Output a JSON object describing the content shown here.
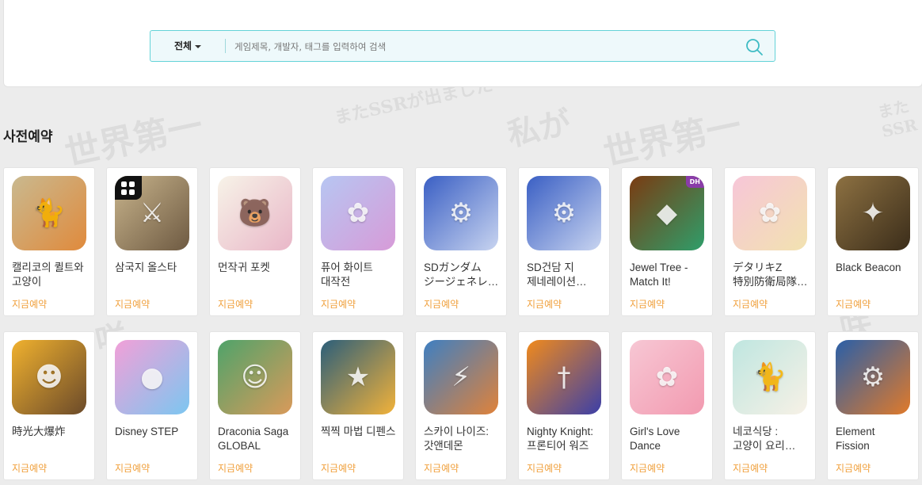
{
  "search": {
    "category": "전체",
    "placeholder": "게임제목, 개발자, 태그를 입력하여 검색",
    "value": ""
  },
  "section": {
    "title": "사전예약"
  },
  "colors": {
    "accent": "#64d3d8",
    "status": "#f0a03c"
  },
  "rows": [
    [
      {
        "title": "캘리코의 퀼트와 고양이",
        "status": "지금예약",
        "icon": "cat-icon",
        "colors": [
          "#c9b98f",
          "#e08a3c"
        ]
      },
      {
        "title": "삼국지 올스타",
        "status": "지금예약",
        "icon": "warrior-icon",
        "colors": [
          "#c8b48c",
          "#6e5a42"
        ]
      },
      {
        "title": "먼작귀 포켓",
        "status": "지금예약",
        "icon": "bear-icon",
        "colors": [
          "#f7f3e8",
          "#e9b7c8"
        ]
      },
      {
        "title": "퓨어 화이트 대작전",
        "status": "지금예약",
        "icon": "anime-girl-icon",
        "colors": [
          "#b7c6f2",
          "#d79bd8"
        ]
      },
      {
        "title": "SDガンダム ジージェネレーション",
        "status": "지금예약",
        "icon": "robot-icon",
        "colors": [
          "#3a5fc4",
          "#c8d4f0"
        ]
      },
      {
        "title": "SD건담 지 제네레이션 이터널",
        "status": "지금예약",
        "icon": "robot-icon",
        "colors": [
          "#3a5fc4",
          "#c8d4f0"
        ]
      },
      {
        "title": "Jewel Tree - Match It!",
        "status": "지금예약",
        "icon": "jewel-icon",
        "colors": [
          "#7a3b12",
          "#2f9e6a"
        ],
        "badge": "DH"
      },
      {
        "title": "デタリキZ 特別防衛局隊員募集",
        "status": "지금예약",
        "icon": "anime-girl-icon",
        "colors": [
          "#f7c6d8",
          "#f2e2b0"
        ]
      },
      {
        "title": "Black Beacon",
        "status": "지금예약",
        "icon": "character-icon",
        "colors": [
          "#8d7142",
          "#3b2d1a"
        ]
      }
    ],
    [
      {
        "title": "時光大爆炸",
        "status": "지금예약",
        "icon": "caveman-icon",
        "colors": [
          "#f0b12e",
          "#6b4a2a"
        ]
      },
      {
        "title": "Disney STEP",
        "status": "지금예약",
        "icon": "mouse-icon",
        "colors": [
          "#f2a0d8",
          "#7cc6f0"
        ]
      },
      {
        "title": "Draconia Saga GLOBAL",
        "status": "지금예약",
        "icon": "hero-icon",
        "colors": [
          "#4fa36a",
          "#d99a5a"
        ]
      },
      {
        "title": "찍찍 마법 디펜스",
        "status": "지금예약",
        "icon": "mage-icon",
        "colors": [
          "#2b5e7a",
          "#f2b23a"
        ]
      },
      {
        "title": "스카이 나이즈: 갓앤데몬",
        "status": "지금예약",
        "icon": "knight-icon",
        "colors": [
          "#3e7fc2",
          "#e0823a"
        ]
      },
      {
        "title": "Nighty Knight: 프론티어 워즈",
        "status": "지금예약",
        "icon": "sword-icon",
        "colors": [
          "#f08a1c",
          "#3b3fa8"
        ]
      },
      {
        "title": "Girl's Love Dance",
        "status": "지금예약",
        "icon": "anime-girl-icon",
        "colors": [
          "#f7c7d4",
          "#f29ab0"
        ]
      },
      {
        "title": "네코식당 : 고양이 요리 타이쿤",
        "status": "지금예약",
        "icon": "cat-icon",
        "colors": [
          "#bfe6e0",
          "#f7f1e6"
        ]
      },
      {
        "title": "Element Fission",
        "status": "지금예약",
        "icon": "robot-icon",
        "colors": [
          "#2a5fa8",
          "#e07a2a"
        ]
      }
    ]
  ]
}
